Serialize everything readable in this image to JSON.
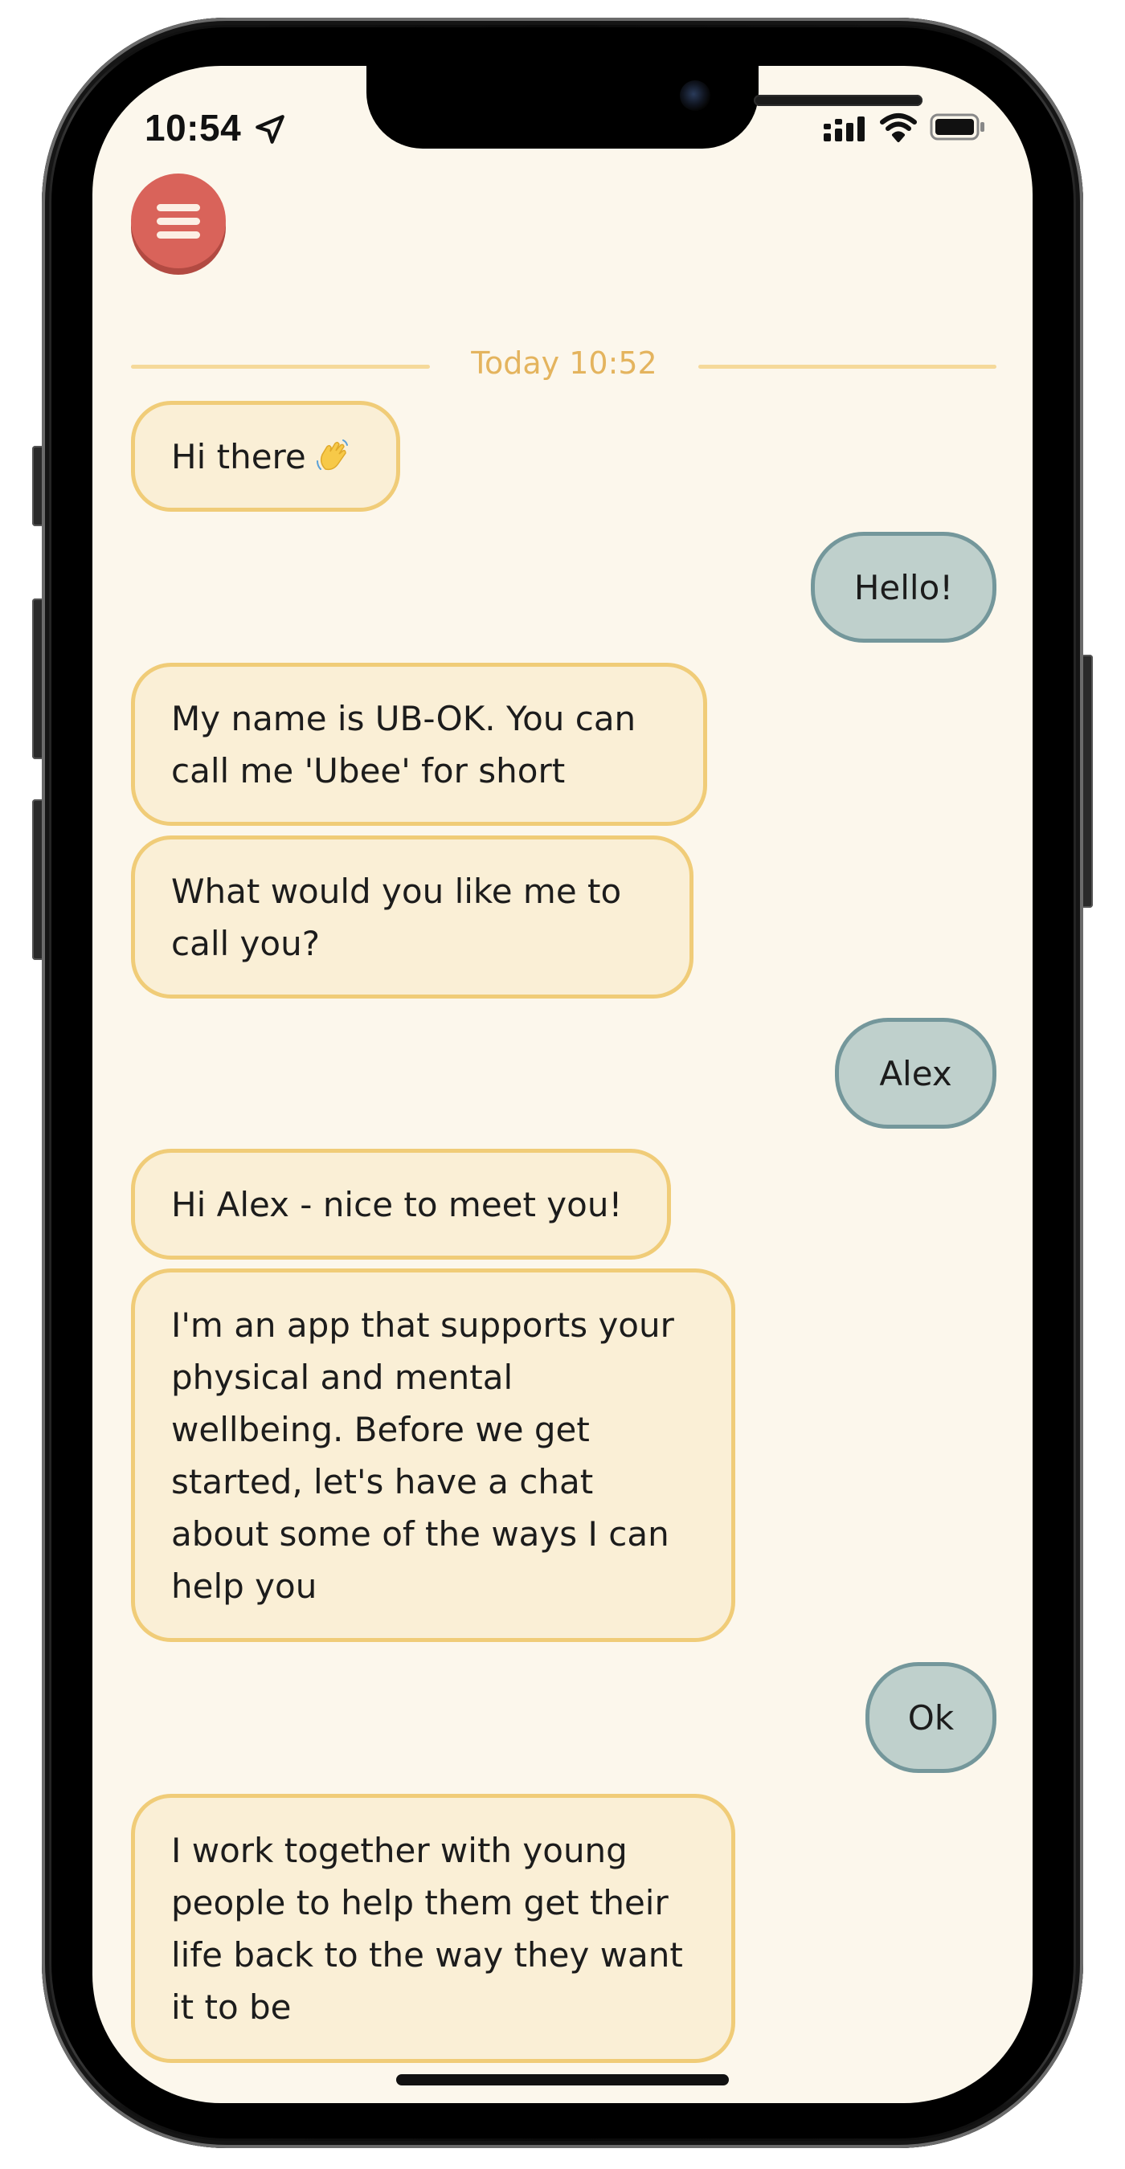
{
  "status_bar": {
    "time": "10:54",
    "icons": [
      "location-arrow-icon",
      "signal-icon",
      "wifi-icon",
      "battery-icon"
    ]
  },
  "menu": {
    "icon": "hamburger-menu-icon"
  },
  "divider": {
    "label": "Today 10:52"
  },
  "messages": [
    {
      "sender": "bot",
      "text": "Hi there"
    },
    {
      "sender": "user",
      "text": "Hello!"
    },
    {
      "sender": "bot",
      "lines": [
        "My name is UB-OK. You can",
        "call me 'Ubee' for short"
      ]
    },
    {
      "sender": "bot",
      "lines": [
        "What would you like me to",
        "call you?"
      ]
    },
    {
      "sender": "user",
      "text": "Alex"
    },
    {
      "sender": "bot",
      "text": "Hi Alex - nice to meet you!"
    },
    {
      "sender": "bot",
      "lines": [
        "I'm an app that supports your",
        "physical and mental",
        "wellbeing. Before we get",
        "started, let's have a chat",
        "about some of the ways I can",
        "help you"
      ]
    },
    {
      "sender": "user",
      "text": "Ok"
    },
    {
      "sender": "bot",
      "lines": [
        "I work together with young",
        "people to help them get their",
        "life back to the way they want",
        "it to be"
      ]
    }
  ],
  "colors": {
    "screen_bg": "#fcf7ec",
    "bot_bubble_bg": "#faefd6",
    "bot_bubble_border": "#f0cc78",
    "user_bubble_bg": "#bfd0cc",
    "user_bubble_border": "#74979b",
    "menu_button": "#d9635a",
    "divider_accent": "#e4b45e"
  }
}
